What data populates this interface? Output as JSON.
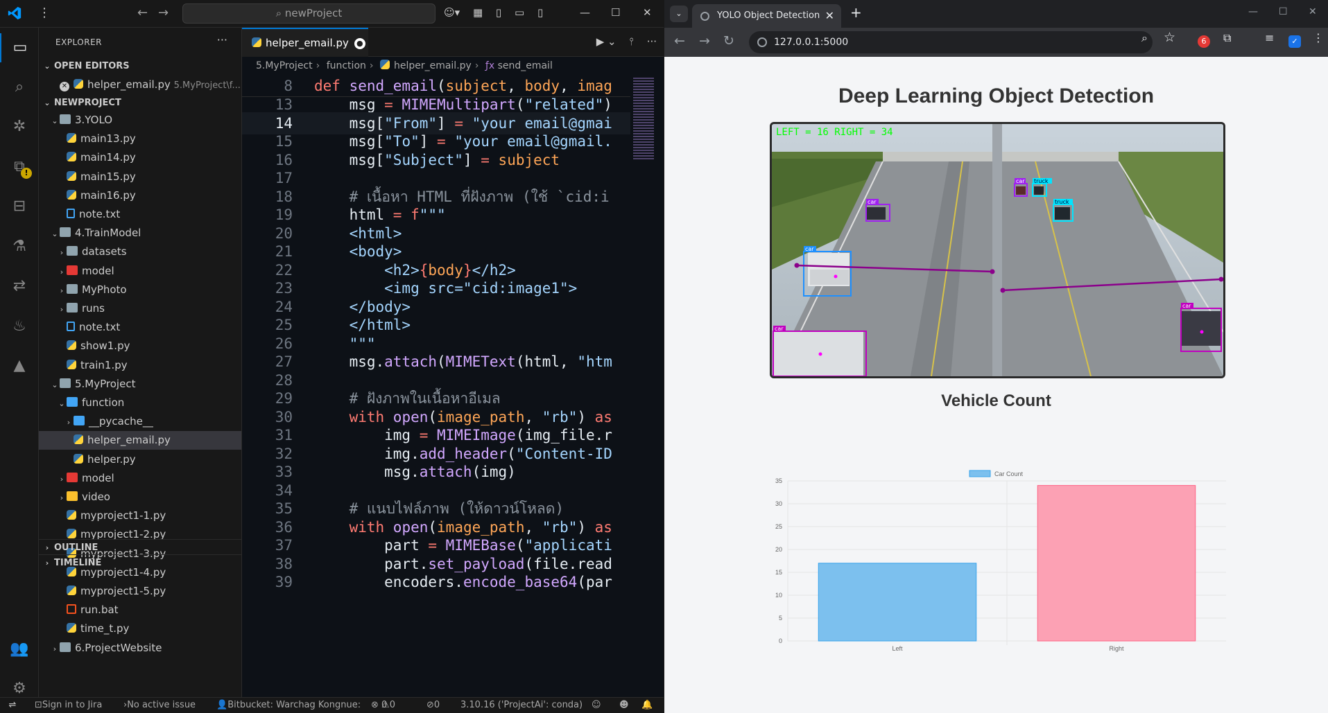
{
  "vscode": {
    "search": "newProject",
    "explorer_title": "EXPLORER",
    "open_editors_label": "OPEN EDITORS",
    "open_editor_item": {
      "name": "helper_email.py",
      "path": "5.MyProject\\f..."
    },
    "project_label": "NEWPROJECT",
    "tree": [
      {
        "label": "3.YOLO",
        "indent": 1,
        "kind": "folder-open"
      },
      {
        "label": "main13.py",
        "indent": 2,
        "kind": "py"
      },
      {
        "label": "main14.py",
        "indent": 2,
        "kind": "py"
      },
      {
        "label": "main15.py",
        "indent": 2,
        "kind": "py"
      },
      {
        "label": "main16.py",
        "indent": 2,
        "kind": "py"
      },
      {
        "label": "note.txt",
        "indent": 2,
        "kind": "txt"
      },
      {
        "label": "4.TrainModel",
        "indent": 1,
        "kind": "folder-open"
      },
      {
        "label": "datasets",
        "indent": 2,
        "kind": "folder"
      },
      {
        "label": "model",
        "indent": 2,
        "kind": "folder-red"
      },
      {
        "label": "MyPhoto",
        "indent": 2,
        "kind": "folder"
      },
      {
        "label": "runs",
        "indent": 2,
        "kind": "folder"
      },
      {
        "label": "note.txt",
        "indent": 2,
        "kind": "txt"
      },
      {
        "label": "show1.py",
        "indent": 2,
        "kind": "py"
      },
      {
        "label": "train1.py",
        "indent": 2,
        "kind": "py"
      },
      {
        "label": "5.MyProject",
        "indent": 1,
        "kind": "folder-open"
      },
      {
        "label": "function",
        "indent": 2,
        "kind": "folder-blue-open"
      },
      {
        "label": "__pycache__",
        "indent": 3,
        "kind": "folder-blue"
      },
      {
        "label": "helper_email.py",
        "indent": 3,
        "kind": "py",
        "selected": true
      },
      {
        "label": "helper.py",
        "indent": 3,
        "kind": "py"
      },
      {
        "label": "model",
        "indent": 2,
        "kind": "folder-red"
      },
      {
        "label": "video",
        "indent": 2,
        "kind": "folder-yellow"
      },
      {
        "label": "myproject1-1.py",
        "indent": 2,
        "kind": "py"
      },
      {
        "label": "myproject1-2.py",
        "indent": 2,
        "kind": "py"
      },
      {
        "label": "myproject1-3.py",
        "indent": 2,
        "kind": "py"
      },
      {
        "label": "myproject1-4.py",
        "indent": 2,
        "kind": "py"
      },
      {
        "label": "myproject1-5.py",
        "indent": 2,
        "kind": "py"
      },
      {
        "label": "run.bat",
        "indent": 2,
        "kind": "bat"
      },
      {
        "label": "time_t.py",
        "indent": 2,
        "kind": "py"
      },
      {
        "label": "6.ProjectWebsite",
        "indent": 1,
        "kind": "folder"
      }
    ],
    "outline_label": "OUTLINE",
    "timeline_label": "TIMELINE",
    "tab_label": "helper_email.py",
    "breadcrumb": [
      "5.MyProject",
      "function",
      "helper_email.py",
      "send_email"
    ],
    "code_lines": [
      {
        "n": "8",
        "sticky": true,
        "parts": [
          [
            "kw",
            "def "
          ],
          [
            "fn",
            "send_email"
          ],
          [
            "pl",
            "("
          ],
          [
            "var",
            "subject"
          ],
          [
            "pl",
            ", "
          ],
          [
            "var",
            "body"
          ],
          [
            "pl",
            ", "
          ],
          [
            "var",
            "imag"
          ]
        ]
      },
      {
        "n": "13",
        "parts": [
          [
            "pl",
            "    msg "
          ],
          [
            "kw",
            "= "
          ],
          [
            "fn",
            "MIMEMultipart"
          ],
          [
            "pl",
            "("
          ],
          [
            "str",
            "\"related\""
          ],
          [
            "pl",
            ")"
          ]
        ]
      },
      {
        "n": "14",
        "cur": true,
        "parts": [
          [
            "pl",
            "    msg["
          ],
          [
            "str",
            "\"From\""
          ],
          [
            "pl",
            "] "
          ],
          [
            "kw",
            "= "
          ],
          [
            "str",
            "\"your email@gmai"
          ]
        ]
      },
      {
        "n": "15",
        "parts": [
          [
            "pl",
            "    msg["
          ],
          [
            "str",
            "\"To\""
          ],
          [
            "pl",
            "] "
          ],
          [
            "kw",
            "= "
          ],
          [
            "str",
            "\"your email@gmail."
          ]
        ]
      },
      {
        "n": "16",
        "parts": [
          [
            "pl",
            "    msg["
          ],
          [
            "str",
            "\"Subject\""
          ],
          [
            "pl",
            "] "
          ],
          [
            "kw",
            "= "
          ],
          [
            "var",
            "subject"
          ]
        ]
      },
      {
        "n": "17",
        "parts": [
          [
            "pl",
            ""
          ]
        ]
      },
      {
        "n": "18",
        "parts": [
          [
            "cm",
            "    # เนื้อหา HTML ที่ฝังภาพ (ใช้ `cid:i"
          ]
        ]
      },
      {
        "n": "19",
        "parts": [
          [
            "pl",
            "    html "
          ],
          [
            "kw",
            "= "
          ],
          [
            "kw",
            "f"
          ],
          [
            "str",
            "\"\"\""
          ]
        ]
      },
      {
        "n": "20",
        "parts": [
          [
            "str",
            "    <html>"
          ]
        ]
      },
      {
        "n": "21",
        "parts": [
          [
            "str",
            "    <body>"
          ]
        ]
      },
      {
        "n": "22",
        "parts": [
          [
            "str",
            "        <h2>"
          ],
          [
            "kw",
            "{"
          ],
          [
            "var",
            "body"
          ],
          [
            "kw",
            "}"
          ],
          [
            "str",
            "</h2>"
          ]
        ]
      },
      {
        "n": "23",
        "parts": [
          [
            "str",
            "        <img src=\"cid:image1\">"
          ]
        ]
      },
      {
        "n": "24",
        "parts": [
          [
            "str",
            "    </body>"
          ]
        ]
      },
      {
        "n": "25",
        "parts": [
          [
            "str",
            "    </html>"
          ]
        ]
      },
      {
        "n": "26",
        "parts": [
          [
            "str",
            "    \"\"\""
          ]
        ]
      },
      {
        "n": "27",
        "parts": [
          [
            "pl",
            "    msg."
          ],
          [
            "fn",
            "attach"
          ],
          [
            "pl",
            "("
          ],
          [
            "fn",
            "MIMEText"
          ],
          [
            "pl",
            "(html, "
          ],
          [
            "str",
            "\"htm"
          ]
        ]
      },
      {
        "n": "28",
        "parts": [
          [
            "pl",
            ""
          ]
        ]
      },
      {
        "n": "29",
        "parts": [
          [
            "cm",
            "    # ฝังภาพในเนื้อหาอีเมล"
          ]
        ]
      },
      {
        "n": "30",
        "parts": [
          [
            "kw",
            "    with "
          ],
          [
            "fn",
            "open"
          ],
          [
            "pl",
            "("
          ],
          [
            "var",
            "image_path"
          ],
          [
            "pl",
            ", "
          ],
          [
            "str",
            "\"rb\""
          ],
          [
            "pl",
            ") "
          ],
          [
            "kw",
            "as"
          ]
        ]
      },
      {
        "n": "31",
        "parts": [
          [
            "pl",
            "        img "
          ],
          [
            "kw",
            "= "
          ],
          [
            "fn",
            "MIMEImage"
          ],
          [
            "pl",
            "(img_file.r"
          ]
        ]
      },
      {
        "n": "32",
        "parts": [
          [
            "pl",
            "        img."
          ],
          [
            "fn",
            "add_header"
          ],
          [
            "pl",
            "("
          ],
          [
            "str",
            "\"Content-ID"
          ]
        ]
      },
      {
        "n": "33",
        "parts": [
          [
            "pl",
            "        msg."
          ],
          [
            "fn",
            "attach"
          ],
          [
            "pl",
            "(img)"
          ]
        ]
      },
      {
        "n": "34",
        "parts": [
          [
            "pl",
            ""
          ]
        ]
      },
      {
        "n": "35",
        "parts": [
          [
            "cm",
            "    # แนบไฟล์ภาพ (ให้ดาวน์โหลด)"
          ]
        ]
      },
      {
        "n": "36",
        "parts": [
          [
            "kw",
            "    with "
          ],
          [
            "fn",
            "open"
          ],
          [
            "pl",
            "("
          ],
          [
            "var",
            "image_path"
          ],
          [
            "pl",
            ", "
          ],
          [
            "str",
            "\"rb\""
          ],
          [
            "pl",
            ") "
          ],
          [
            "kw",
            "as"
          ]
        ]
      },
      {
        "n": "37",
        "parts": [
          [
            "pl",
            "        part "
          ],
          [
            "kw",
            "= "
          ],
          [
            "fn",
            "MIMEBase"
          ],
          [
            "pl",
            "("
          ],
          [
            "str",
            "\"applicati"
          ]
        ]
      },
      {
        "n": "38",
        "parts": [
          [
            "pl",
            "        part."
          ],
          [
            "fn",
            "set_payload"
          ],
          [
            "pl",
            "(file.read"
          ]
        ]
      },
      {
        "n": "39",
        "parts": [
          [
            "pl",
            "        encoders."
          ],
          [
            "fn",
            "encode_base64"
          ],
          [
            "pl",
            "(par"
          ]
        ]
      }
    ],
    "status": {
      "jira": "Sign in to Jira",
      "issue": "No active issue",
      "bitbucket": "Bitbucket: Warchag Kongnue:",
      "errors": "0",
      "warnings": "0",
      "ports": "0",
      "python": "3.10.16 ('ProjectAi': conda)"
    }
  },
  "browser": {
    "tab_title": "YOLO Object Detection",
    "url": "127.0.0.1:5000",
    "page_title": "Deep Learning Object Detection",
    "overlay_counter": "LEFT = 16 RIGHT = 34",
    "detections": [
      {
        "label": "car",
        "color": "#a020f0"
      },
      {
        "label": "car",
        "color": "#a020f0"
      },
      {
        "label": "truck",
        "color": "#00e5ff"
      },
      {
        "label": "truck",
        "color": "#00e5ff"
      },
      {
        "label": "car",
        "color": "#1e90ff"
      },
      {
        "label": "car",
        "color": "#c000c0"
      },
      {
        "label": "car",
        "color": "#c000c0"
      }
    ],
    "chart_title": "Vehicle Count"
  },
  "colors": {
    "bar_left": "#7cc0ee",
    "bar_right": "#fca1b4",
    "accent": "#0078d4"
  },
  "chart_data": {
    "type": "bar",
    "categories": [
      "Left",
      "Right"
    ],
    "series": [
      {
        "name": "Car Count",
        "values": [
          17,
          34
        ]
      }
    ],
    "yticks": [
      "0",
      "5",
      "10",
      "15",
      "20",
      "25",
      "30",
      "35"
    ],
    "ylim": [
      0,
      35
    ],
    "legend": "top",
    "grid": true
  }
}
